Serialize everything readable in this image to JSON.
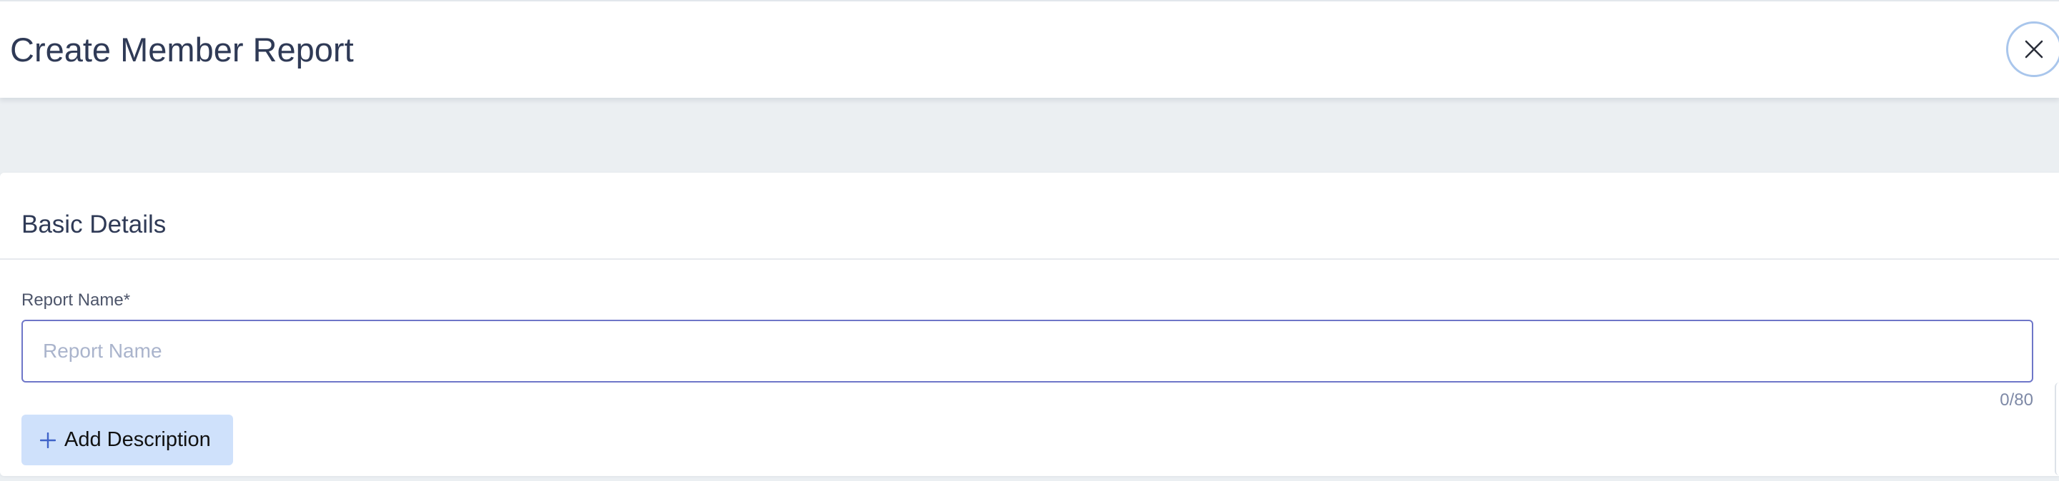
{
  "header": {
    "title": "Create Member Report",
    "close_icon": "close-icon"
  },
  "basic_details": {
    "section_title": "Basic Details",
    "report_name": {
      "label": "Report Name*",
      "value": "",
      "placeholder": "Report Name",
      "counter": "0/80"
    },
    "add_description": {
      "label": "Add Description",
      "icon": "plus-icon"
    }
  },
  "colors": {
    "accent_border": "#6e76c8",
    "button_bg": "#cfe1fb",
    "close_ring": "#a9c6ec",
    "title_text": "#2f3a56"
  }
}
